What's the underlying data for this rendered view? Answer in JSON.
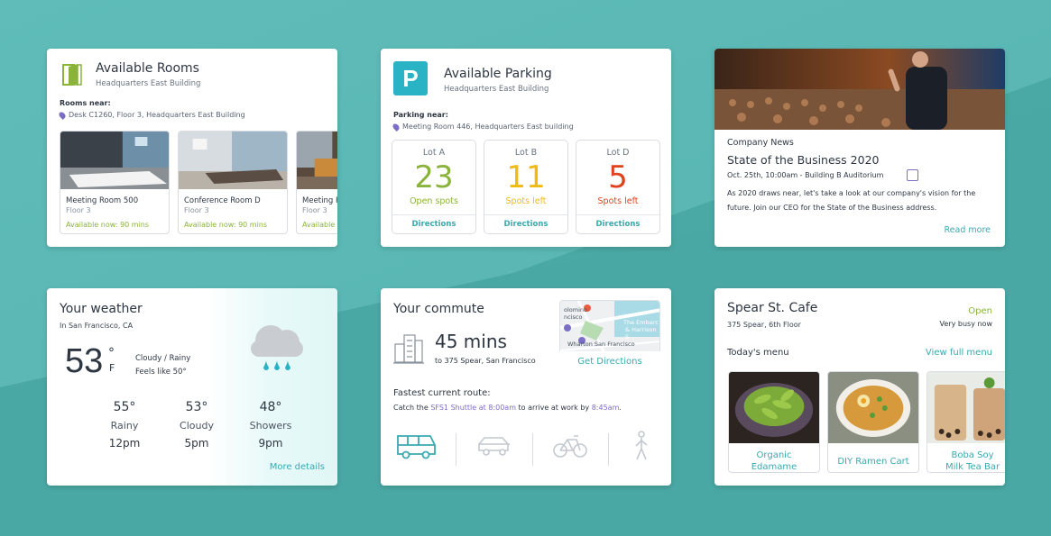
{
  "colors": {
    "accent": "#3aa9b0",
    "green": "#8ab33b",
    "yellow": "#f2b90f",
    "red": "#e0421f",
    "purple": "#7a6fc4"
  },
  "rooms": {
    "title": "Available Rooms",
    "subtitle": "Headquarters East Building",
    "near_label": "Rooms near:",
    "near_value": "Desk C1260, Floor 3, Headquarters East Building",
    "items": [
      {
        "name": "Meeting Room 500",
        "floor": "Floor 3",
        "availability": "Available now:  90 mins"
      },
      {
        "name": "Conference Room D",
        "floor": "Floor 3",
        "availability": "Available now:  90 mins"
      },
      {
        "name": "Meeting R",
        "floor": "Floor 3",
        "availability": "Available"
      }
    ]
  },
  "parking": {
    "icon_letter": "P",
    "title": "Available Parking",
    "subtitle": "Headquarters East Building",
    "near_label": "Parking near:",
    "near_value": "Meeting Room 446, Headquarters East building",
    "lots": [
      {
        "name": "Lot A",
        "count": "23",
        "label": "Open spots",
        "directions": "Directions",
        "color": "#8ab33b"
      },
      {
        "name": "Lot B",
        "count": "11",
        "label": "Spots left",
        "directions": "Directions",
        "color": "#f2b90f"
      },
      {
        "name": "Lot D",
        "count": "5",
        "label": "Spots left",
        "directions": "Directions",
        "color": "#e0421f"
      }
    ]
  },
  "news": {
    "category": "Company News",
    "title": "State of the Business 2020",
    "date": "Oct. 25th, 10:00am - Building B Auditorium",
    "body": "As 2020 draws near, let's take a look at our company's vision for the future. Join our CEO for the State of the Business address.",
    "read_more": "Read more"
  },
  "weather": {
    "title": "Your weather",
    "location": "In San Francisco, CA",
    "temp": "53",
    "degree": "°",
    "unit": "F",
    "condition": "Cloudy / Rainy",
    "feels_like": "Feels like  50°",
    "forecast": [
      {
        "temp": "55°",
        "cond": "Rainy",
        "time": "12pm"
      },
      {
        "temp": "53°",
        "cond": "Cloudy",
        "time": "5pm"
      },
      {
        "temp": "48°",
        "cond": "Showers",
        "time": "9pm"
      }
    ],
    "more_details": "More details"
  },
  "commute": {
    "title": "Your commute",
    "time": "45 mins",
    "destination": "to 375 Spear, San Francisco",
    "map_labels": [
      "olomino",
      "ncisco",
      "The Embarc",
      "& Harrison S",
      "Wharton San Francisco"
    ],
    "get_directions": "Get Directions",
    "route_label": "Fastest current route:",
    "route_pre": "Catch the ",
    "route_shuttle": "SFS1 Shuttle at 8:00am",
    "route_mid": " to arrive at work by ",
    "route_arrive": "8:45am",
    "route_post": ".",
    "modes": [
      "bus-icon",
      "car-icon",
      "bike-icon",
      "walk-icon"
    ]
  },
  "cafe": {
    "title": "Spear St. Cafe",
    "address": "375 Spear, 6th Floor",
    "status": "Open",
    "busy": "Very busy now",
    "menu_label": "Today's menu",
    "view_menu": "View full menu",
    "items": [
      {
        "line1": "Organic",
        "line2": "Edamame"
      },
      {
        "line1": "DIY Ramen Cart",
        "line2": ""
      },
      {
        "line1": "Boba Soy",
        "line2": "Milk Tea Bar"
      }
    ]
  }
}
